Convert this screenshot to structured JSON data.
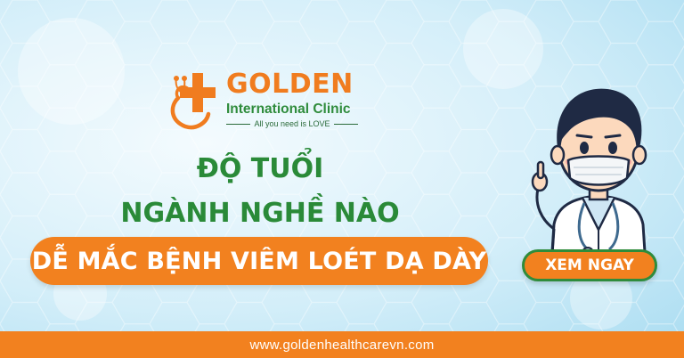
{
  "logo": {
    "title": "GOLDEN",
    "subtitle": "International Clinic",
    "tagline": "All you need is LOVE",
    "icon": "medical-cross-heart-logo"
  },
  "headline": {
    "line1": "ĐỘ TUỔI",
    "line2": "NGÀNH NGHỀ NÀO",
    "highlight": "DỄ MẮC BỆNH VIÊM LOÉT DẠ DÀY"
  },
  "cta": {
    "label": "XEM NGAY"
  },
  "footer": {
    "url": "www.goldenhealthcarevn.com"
  },
  "colors": {
    "brand_orange": "#f2811f",
    "brand_green": "#2a8a38",
    "background": "#d3eef9"
  }
}
